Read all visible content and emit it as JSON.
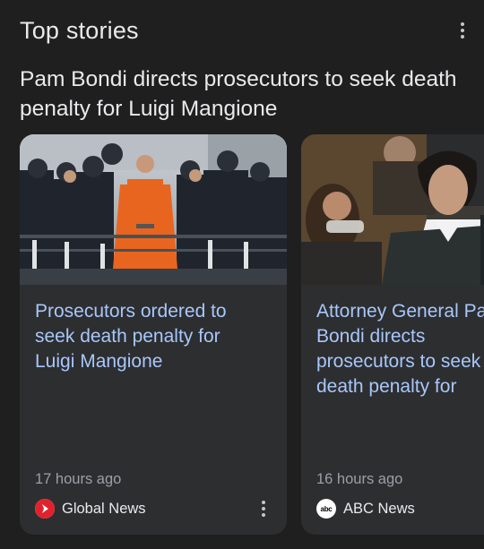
{
  "section": {
    "title": "Top stories",
    "more_icon": "more-vert-icon"
  },
  "headline": "Pam Bondi directs prosecutors to seek death penalty for Luigi Mangione",
  "cards": [
    {
      "title_lines": [
        "Prosecutors ordered to",
        "seek death penalty for",
        "Luigi Mangione"
      ],
      "time": "17 hours ago",
      "source": "Global News",
      "source_icon": "global-news-logo-icon",
      "image": "perp-walk-photo"
    },
    {
      "title_lines": [
        "Attorney General Pam",
        "Bondi directs",
        "prosecutors to seek",
        "death penalty for"
      ],
      "time": "16 hours ago",
      "source": "ABC News",
      "source_icon": "abc-news-logo-icon",
      "logo_text": "abc",
      "image": "courtroom-photo"
    }
  ],
  "colors": {
    "background": "#1f1f1f",
    "card": "#2d2e30",
    "link": "#a8c7fa",
    "muted": "#9aa0a6",
    "global_news_red": "#e1222d"
  }
}
